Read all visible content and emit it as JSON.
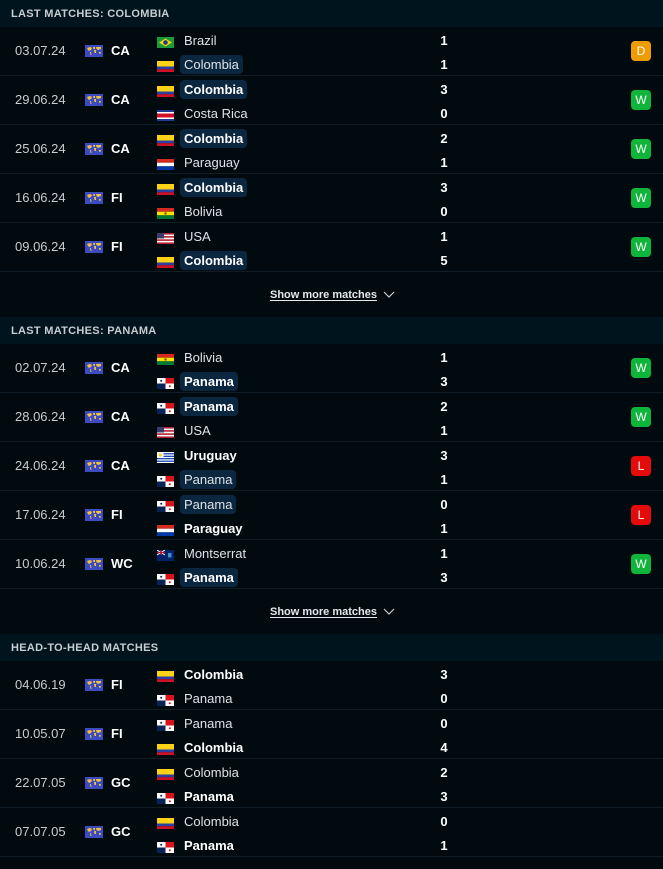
{
  "colors": {
    "win": "#0fb53a",
    "draw": "#f09c00",
    "loss": "#e30b0b",
    "header_bg": "#00141e",
    "page_bg": "#010a0f",
    "highlight_bg": "#0b2740"
  },
  "sections": [
    {
      "title": "LAST MATCHES: COLOMBIA",
      "show_more": "Show more matches",
      "matches": [
        {
          "date": "03.07.24",
          "comp": "CA",
          "home": {
            "name": "Brazil",
            "flag": "brazil",
            "score": "1",
            "hl": false,
            "win": false
          },
          "away": {
            "name": "Colombia",
            "flag": "colombia",
            "score": "1",
            "hl": true,
            "win": false
          },
          "result": "D"
        },
        {
          "date": "29.06.24",
          "comp": "CA",
          "home": {
            "name": "Colombia",
            "flag": "colombia",
            "score": "3",
            "hl": true,
            "win": true
          },
          "away": {
            "name": "Costa Rica",
            "flag": "costa-rica",
            "score": "0",
            "hl": false,
            "win": false
          },
          "result": "W"
        },
        {
          "date": "25.06.24",
          "comp": "CA",
          "home": {
            "name": "Colombia",
            "flag": "colombia",
            "score": "2",
            "hl": true,
            "win": true
          },
          "away": {
            "name": "Paraguay",
            "flag": "paraguay",
            "score": "1",
            "hl": false,
            "win": false
          },
          "result": "W"
        },
        {
          "date": "16.06.24",
          "comp": "FI",
          "home": {
            "name": "Colombia",
            "flag": "colombia",
            "score": "3",
            "hl": true,
            "win": true
          },
          "away": {
            "name": "Bolivia",
            "flag": "bolivia",
            "score": "0",
            "hl": false,
            "win": false
          },
          "result": "W"
        },
        {
          "date": "09.06.24",
          "comp": "FI",
          "home": {
            "name": "USA",
            "flag": "usa",
            "score": "1",
            "hl": false,
            "win": false
          },
          "away": {
            "name": "Colombia",
            "flag": "colombia",
            "score": "5",
            "hl": true,
            "win": true
          },
          "result": "W"
        }
      ]
    },
    {
      "title": "LAST MATCHES: PANAMA",
      "show_more": "Show more matches",
      "matches": [
        {
          "date": "02.07.24",
          "comp": "CA",
          "home": {
            "name": "Bolivia",
            "flag": "bolivia",
            "score": "1",
            "hl": false,
            "win": false
          },
          "away": {
            "name": "Panama",
            "flag": "panama",
            "score": "3",
            "hl": true,
            "win": true
          },
          "result": "W"
        },
        {
          "date": "28.06.24",
          "comp": "CA",
          "home": {
            "name": "Panama",
            "flag": "panama",
            "score": "2",
            "hl": true,
            "win": true
          },
          "away": {
            "name": "USA",
            "flag": "usa",
            "score": "1",
            "hl": false,
            "win": false
          },
          "result": "W"
        },
        {
          "date": "24.06.24",
          "comp": "CA",
          "home": {
            "name": "Uruguay",
            "flag": "uruguay",
            "score": "3",
            "hl": false,
            "win": true
          },
          "away": {
            "name": "Panama",
            "flag": "panama",
            "score": "1",
            "hl": true,
            "win": false
          },
          "result": "L"
        },
        {
          "date": "17.06.24",
          "comp": "FI",
          "home": {
            "name": "Panama",
            "flag": "panama",
            "score": "0",
            "hl": true,
            "win": false
          },
          "away": {
            "name": "Paraguay",
            "flag": "paraguay",
            "score": "1",
            "hl": false,
            "win": true
          },
          "result": "L"
        },
        {
          "date": "10.06.24",
          "comp": "WC",
          "home": {
            "name": "Montserrat",
            "flag": "montserrat",
            "score": "1",
            "hl": false,
            "win": false
          },
          "away": {
            "name": "Panama",
            "flag": "panama",
            "score": "3",
            "hl": true,
            "win": true
          },
          "result": "W"
        }
      ]
    },
    {
      "title": "HEAD-TO-HEAD MATCHES",
      "matches": [
        {
          "date": "04.06.19",
          "comp": "FI",
          "home": {
            "name": "Colombia",
            "flag": "colombia",
            "score": "3",
            "hl": false,
            "win": true
          },
          "away": {
            "name": "Panama",
            "flag": "panama",
            "score": "0",
            "hl": false,
            "win": false
          }
        },
        {
          "date": "10.05.07",
          "comp": "FI",
          "home": {
            "name": "Panama",
            "flag": "panama",
            "score": "0",
            "hl": false,
            "win": false
          },
          "away": {
            "name": "Colombia",
            "flag": "colombia",
            "score": "4",
            "hl": false,
            "win": true
          }
        },
        {
          "date": "22.07.05",
          "comp": "GC",
          "home": {
            "name": "Colombia",
            "flag": "colombia",
            "score": "2",
            "hl": false,
            "win": false
          },
          "away": {
            "name": "Panama",
            "flag": "panama",
            "score": "3",
            "hl": false,
            "win": true
          }
        },
        {
          "date": "07.07.05",
          "comp": "GC",
          "home": {
            "name": "Colombia",
            "flag": "colombia",
            "score": "0",
            "hl": false,
            "win": false
          },
          "away": {
            "name": "Panama",
            "flag": "panama",
            "score": "1",
            "hl": false,
            "win": true
          }
        }
      ]
    }
  ]
}
